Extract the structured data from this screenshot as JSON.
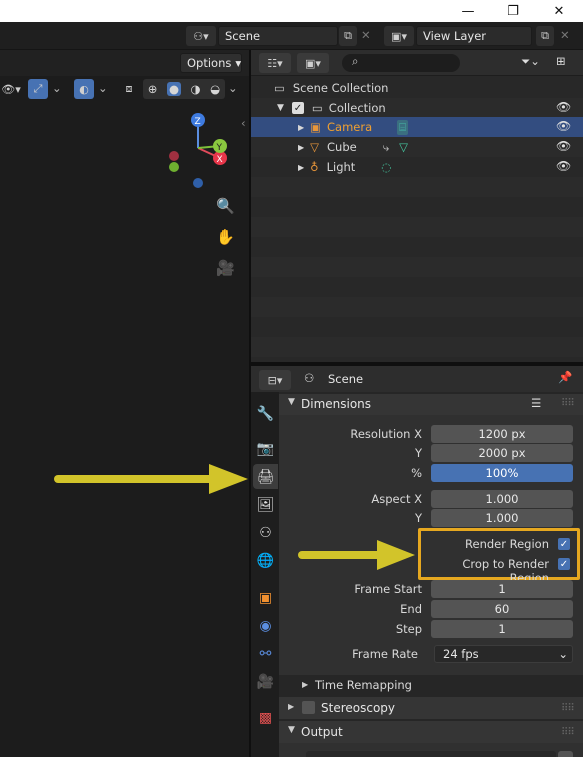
{
  "titlebar": {
    "minimize": "—",
    "maximize": "❐",
    "close": "✕"
  },
  "topbar": {
    "scene_label": "Scene",
    "view_layer_label": "View Layer"
  },
  "viewport": {
    "options_label": "Options"
  },
  "outliner": {
    "scene_collection": "Scene Collection",
    "collection": "Collection",
    "items": [
      {
        "label": "Camera"
      },
      {
        "label": "Cube"
      },
      {
        "label": "Light"
      }
    ]
  },
  "props": {
    "context": "Scene",
    "dimensions_title": "Dimensions",
    "res_x_label": "Resolution X",
    "res_x": "1200 px",
    "res_y_label": "Y",
    "res_y": "2000 px",
    "pct_label": "%",
    "pct": "100%",
    "aspect_x_label": "Aspect X",
    "aspect_x": "1.000",
    "aspect_y_label": "Y",
    "aspect_y": "1.000",
    "render_region": "Render Region",
    "crop_region": "Crop to Render Region",
    "frame_start_label": "Frame Start",
    "frame_start": "1",
    "end_label": "End",
    "end": "60",
    "step_label": "Step",
    "step": "1",
    "frame_rate_label": "Frame Rate",
    "frame_rate": "24 fps",
    "time_remap": "Time Remapping",
    "stereoscopy": "Stereoscopy",
    "output": "Output"
  },
  "colors": {
    "accent": "#4772b3",
    "highlight": "#e6a820",
    "arrow": "#d2c42a"
  }
}
